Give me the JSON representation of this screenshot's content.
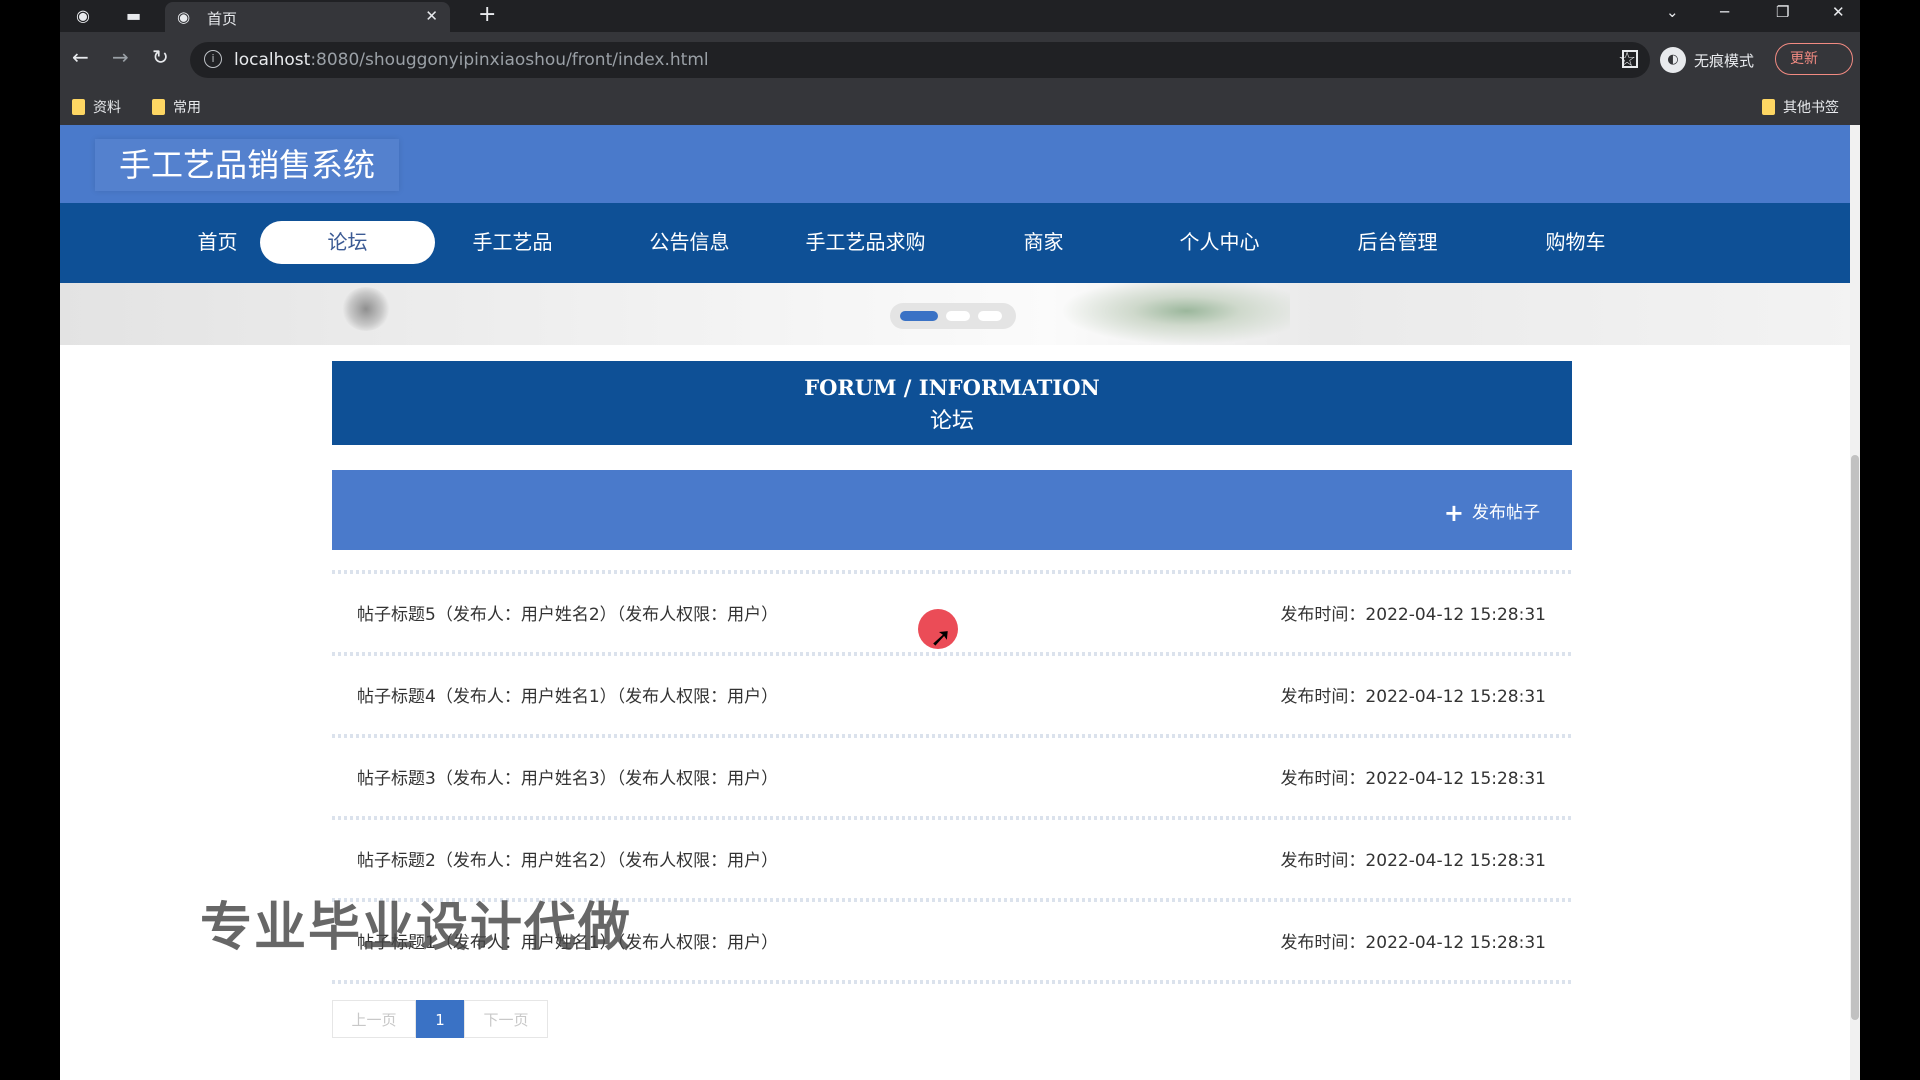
{
  "browser": {
    "tab_title": "首页",
    "tab_close": "✕",
    "new_tab": "+",
    "url_host": "localhost",
    "url_rest": ":8080/shouggonyipinxiaoshou/front/index.html",
    "incognito_label": "无痕模式",
    "update_label": "更新",
    "update_menu": "⋮",
    "bookmarks": [
      "资料",
      "常用"
    ],
    "other_bookmarks": "其他书签"
  },
  "site": {
    "title": "手工艺品销售系统",
    "nav": [
      "首页",
      "论坛",
      "手工艺品",
      "公告信息",
      "手工艺品求购",
      "商家",
      "个人中心",
      "后台管理",
      "购物车"
    ],
    "active_nav": "论坛"
  },
  "forum": {
    "heading_en": "FORUM / INFORMATION",
    "heading_zh": "论坛",
    "post_button": "发布帖子",
    "posts": [
      {
        "title": "帖子标题5（发布人：用户姓名2）（发布人权限：用户）",
        "time": "发布时间：2022-04-12 15:28:31"
      },
      {
        "title": "帖子标题4（发布人：用户姓名1）（发布人权限：用户）",
        "time": "发布时间：2022-04-12 15:28:31"
      },
      {
        "title": "帖子标题3（发布人：用户姓名3）（发布人权限：用户）",
        "time": "发布时间：2022-04-12 15:28:31"
      },
      {
        "title": "帖子标题2（发布人：用户姓名2）（发布人权限：用户）",
        "time": "发布时间：2022-04-12 15:28:31"
      },
      {
        "title": "帖子标题1（发布人：用户姓名1）（发布人权限：用户）",
        "time": "发布时间：2022-04-12 15:28:31"
      }
    ]
  },
  "pager": {
    "prev": "上一页",
    "current": "1",
    "next": "下一页"
  },
  "watermark": "专业毕业设计代做",
  "colors": {
    "header": "#4a7acb",
    "nav": "#0e5096",
    "accent": "#3a72c5"
  }
}
